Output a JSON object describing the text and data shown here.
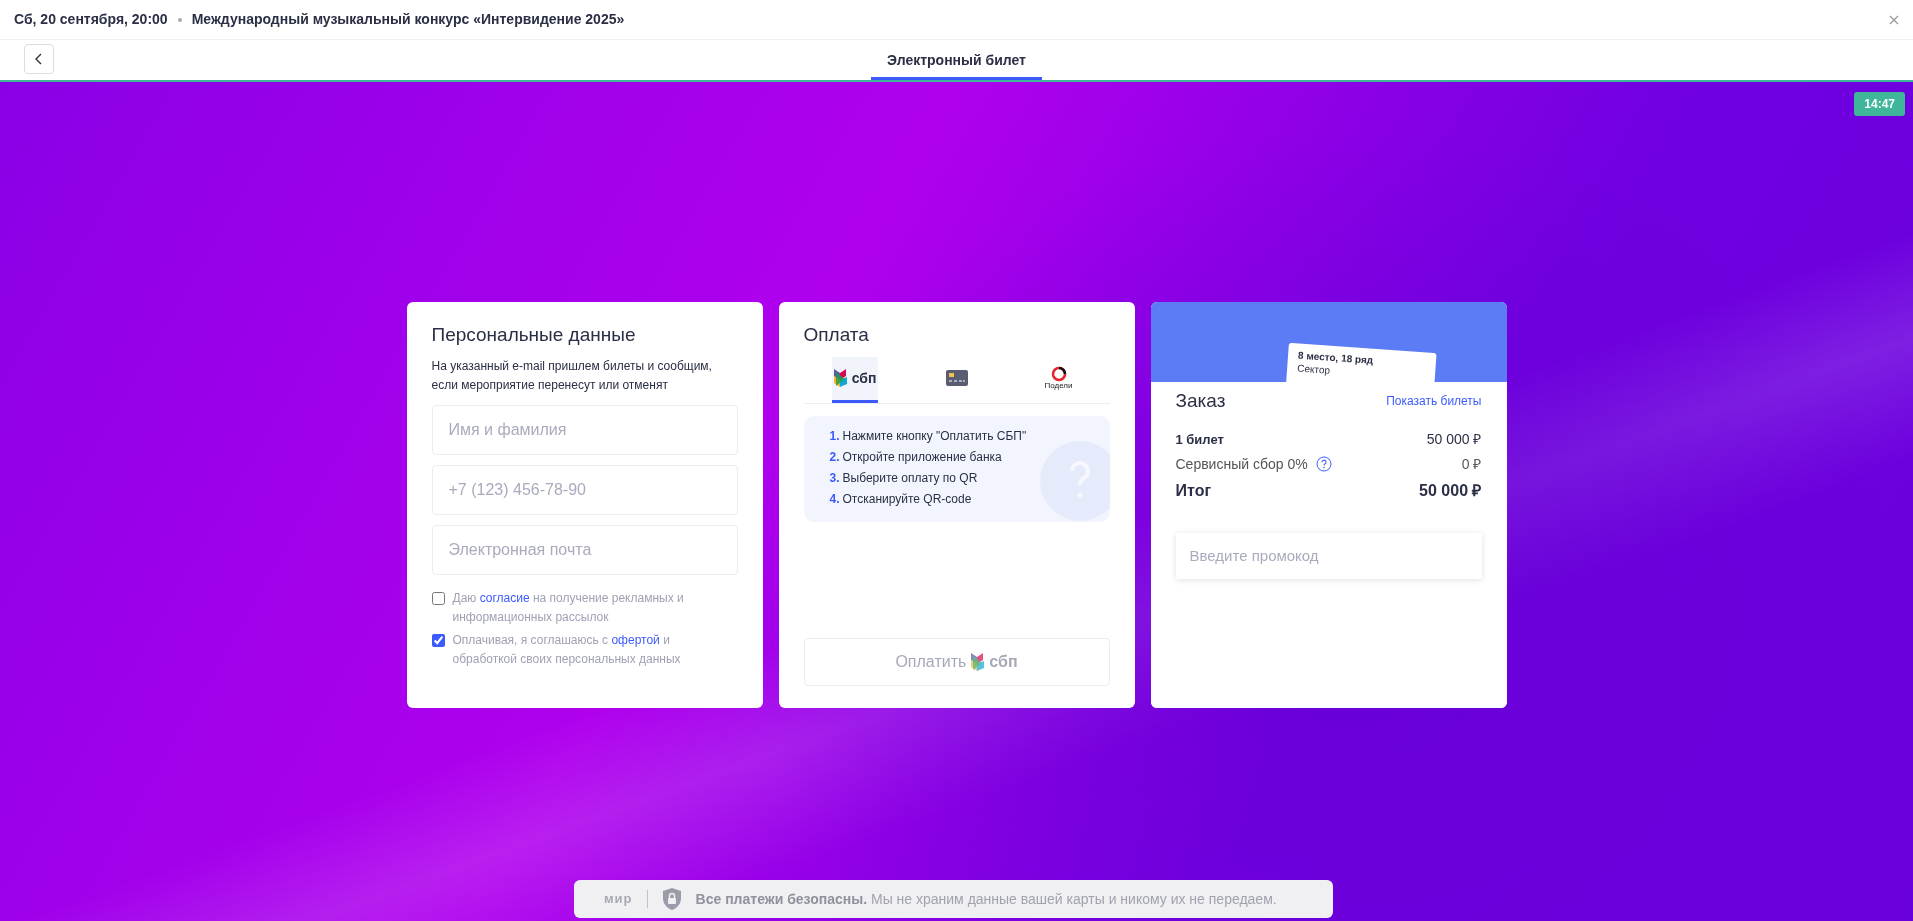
{
  "header": {
    "date": "Сб, 20 сентября, 20:00",
    "event_title": "Международный музыкальный конкурс «Интервидение 2025»"
  },
  "nav": {
    "tabs": [
      {
        "label": "Электронный билет",
        "selected": true
      }
    ]
  },
  "timer": "14:47",
  "personal": {
    "title": "Персональные данные",
    "description": "На указанный e-mail пришлем билеты и сообщим, если мероприятие перенесут или отменят",
    "fields": [
      {
        "placeholder": "Имя и фамилия"
      },
      {
        "placeholder": "+7 (123) 456-78-90"
      },
      {
        "placeholder": "Электронная почта"
      }
    ],
    "checkboxes": [
      {
        "text_before": "Даю",
        "link": "согласие",
        "text_after": "на получение рекламных и информационных рассылок",
        "checked": false
      },
      {
        "text_before": "Оплачивая, я соглашаюсь с",
        "link": "офертой",
        "text_after": "и обработкой своих персональных данных",
        "checked": true
      }
    ]
  },
  "payment": {
    "title": "Оплата",
    "methods": [
      {
        "kind": "sbp",
        "label": "сбп",
        "selected": true
      },
      {
        "kind": "card",
        "selected": false
      },
      {
        "kind": "podeli",
        "label": "Подели",
        "selected": false
      }
    ],
    "steps": [
      {
        "number": "1.",
        "text": "Нажмите кнопку \"Оплатить СБП\""
      },
      {
        "number": "2.",
        "text": "Откройте приложение банка"
      },
      {
        "number": "3.",
        "text": "Выберите оплату по QR"
      },
      {
        "number": "4.",
        "text": "Отсканируйте QR-code"
      }
    ],
    "pay_button": {
      "label": "Оплатить",
      "logo_text": "сбп"
    }
  },
  "order": {
    "ticket": {
      "line_1": "8 место, 18 ряд",
      "line_2": "Сектор"
    },
    "title": "Заказ",
    "show_tickets": "Показать билеты",
    "lines": [
      {
        "kind": "item",
        "label": "1 билет",
        "value": "50 000 ₽"
      },
      {
        "kind": "fee",
        "label": "Сервисный сбор 0%",
        "value": "0 ₽"
      },
      {
        "kind": "total",
        "label": "Итог",
        "value": "50 000 ₽"
      }
    ],
    "promo": {
      "placeholder": "Введите промокод"
    }
  },
  "footer": {
    "logo_text": "мир",
    "bold": "Все платежи безопасны.",
    "text": "Мы не храним данные вашей карты и никому их не передаем."
  }
}
